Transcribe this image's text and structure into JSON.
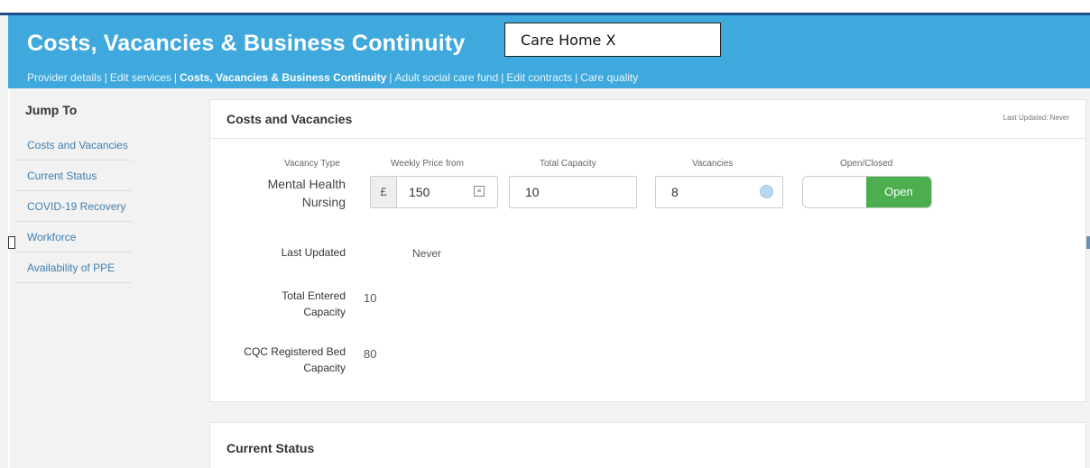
{
  "header": {
    "title": "Costs, Vacancies & Business Continuity",
    "care_home": "Care Home X",
    "nav": [
      {
        "label": "Provider details",
        "active": false
      },
      {
        "label": "Edit services",
        "active": false
      },
      {
        "label": "Costs, Vacancies & Business Continuity",
        "active": true
      },
      {
        "label": "Adult social care fund",
        "active": false
      },
      {
        "label": "Edit contracts",
        "active": false
      },
      {
        "label": "Care quality",
        "active": true
      }
    ],
    "separator": "|"
  },
  "sidebar": {
    "title": "Jump To",
    "items": [
      {
        "label": "Costs and Vacancies"
      },
      {
        "label": "Current Status"
      },
      {
        "label": "COVID-19 Recovery"
      },
      {
        "label": "Workforce"
      },
      {
        "label": "Availability of PPE"
      }
    ]
  },
  "costs_card": {
    "title": "Costs and Vacancies",
    "last_updated_top": "Last Updated: Never",
    "columns": {
      "vacancy_type": "Vacancy Type",
      "weekly_price": "Weekly Price from",
      "total_capacity": "Total Capacity",
      "vacancies": "Vacancies",
      "open_closed": "Open/Closed"
    },
    "row": {
      "vacancy_type_line1": "Mental Health",
      "vacancy_type_line2": "Nursing",
      "currency": "£",
      "weekly_price": "150",
      "total_capacity": "10",
      "vacancies": "8",
      "status": "Open"
    },
    "last_updated_label": "Last Updated",
    "last_updated_value": "Never",
    "total_entered_line1": "Total Entered",
    "total_entered_line2": "Capacity",
    "total_entered_value": "10",
    "cqc_line1": "CQC Registered Bed",
    "cqc_line2": "Capacity",
    "cqc_value": "80"
  },
  "status_card": {
    "title": "Current Status"
  },
  "colors": {
    "header_bg": "#3fa9dd",
    "open_green": "#4cae4f",
    "link_blue": "#3f7fb0"
  }
}
